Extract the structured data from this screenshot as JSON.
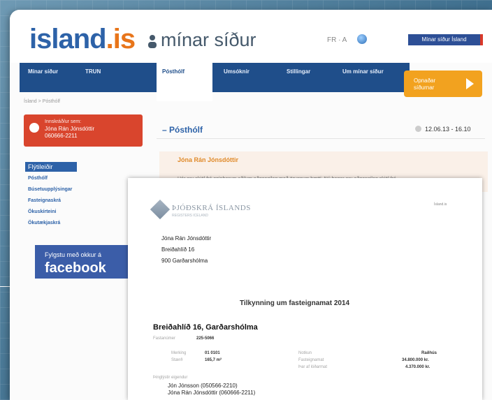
{
  "header": {
    "logo_text": "island",
    "logo_dot": ".is",
    "minar": "mínar síður",
    "lang": "FR · A",
    "top_button": "Mínar síður Ísland"
  },
  "nav": {
    "items": [
      "Mínar síður",
      "TRUN",
      "Pósthólf",
      "Umsóknir",
      "Stillingar",
      "Um mínar síður"
    ],
    "opnar": "Opnaðar síðurnar"
  },
  "breadcrumb": "Ísland > Pósthólf",
  "user": {
    "line1": "Innskráð/ur sem:",
    "name": "Jóna Rán Jónsdóttir",
    "kt": "060666-2211"
  },
  "sidebar": {
    "heading": "Flýtileiðir",
    "items": [
      "Pósthólf",
      "Búsetuupplýsingar",
      "Fasteignaskrá",
      "Ökuskírteini",
      "Ökutækjaskrá"
    ]
  },
  "facebook": {
    "line1": "Fylgstu með okkur á",
    "line2": "facebook"
  },
  "main": {
    "title": "Pósthólf",
    "datetime": "12.06.13 - 16.10",
    "message_name": "Jóna Rán Jónsdóttir",
    "message_text": "Hér eru skjöl frá opinberum aðilum aðgengileg með öruggum hætti. Nú þegar eru aðgengileg skjöl frá"
  },
  "document": {
    "agency": "ÞJÓÐSKRÁ ÍSLANDS",
    "agency_sub": "REGISTERS ICELAND",
    "corner": "Ísland.is",
    "address": [
      "Jóna Rán Jónsdóttir",
      "Breiðahlíð 16",
      "900 Garðarshólma"
    ],
    "title": "Tilkynning um fasteignamat 2014",
    "property": "Breiðahlíð 16, Garðarshólma",
    "fastanumer_label": "Fastanúmer",
    "fastanumer": "225-5066",
    "merking_label": "Merking",
    "merking": "01 0101",
    "staerd_label": "Stærð",
    "staerd": "165,7 m²",
    "notkun_label": "Notkun",
    "notkun": "Raðhús",
    "fasteignamat_label": "Fasteignamat",
    "fasteignamat": "34.800.000 kr.",
    "lodarmat_label": "Þar af lóðarmat",
    "lodarmat": "4.370.000 kr.",
    "owners_label": "Þinglýstir eigendur",
    "owners": [
      "Jón Jónsson  (050566-2210)",
      "Jóna Rán Jónsdóttir  (060666-2211)"
    ]
  }
}
